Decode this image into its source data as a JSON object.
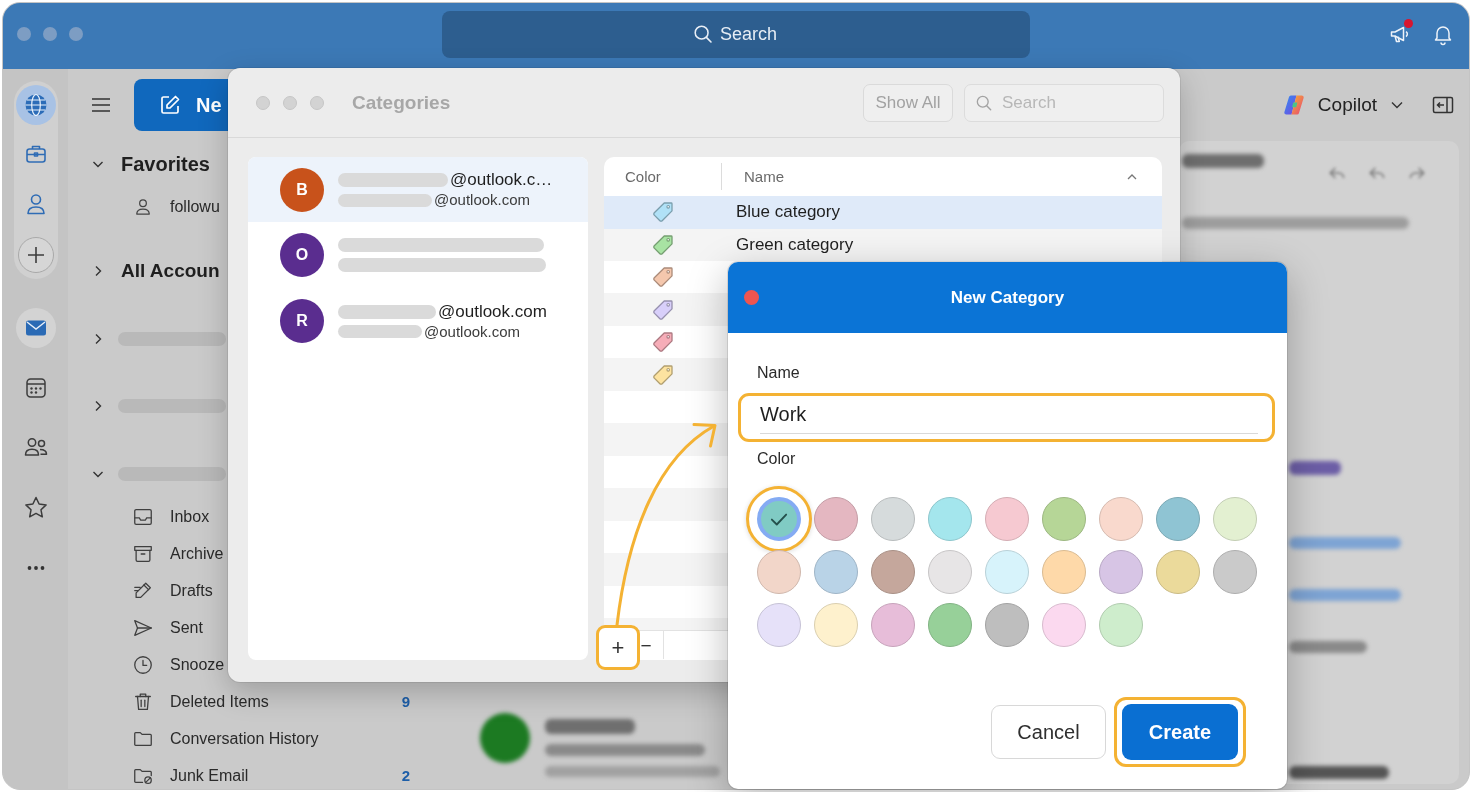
{
  "top_bar": {
    "search": {
      "placeholder": "Search"
    },
    "announcements": {
      "unread": true
    }
  },
  "rail": {
    "accounts": [
      {
        "selected": true
      },
      {
        "selected": false
      },
      {
        "selected": false
      }
    ],
    "apps": [
      {
        "selected": true
      },
      {
        "selected": false
      },
      {
        "selected": false
      },
      {
        "selected": false
      }
    ]
  },
  "toolbar": {
    "new_button": "Ne",
    "copilot": "Copilot"
  },
  "folder_pane": {
    "favorites": {
      "label": "Favorites",
      "expanded": true,
      "items": [
        {
          "label": "followu"
        }
      ]
    },
    "all_accounts": {
      "label": "All Accoun",
      "expanded": false
    },
    "accounts": [
      {
        "expanded": false
      },
      {
        "expanded": false
      },
      {
        "expanded": true,
        "folders": [
          {
            "label": "Inbox"
          },
          {
            "label": "Archive"
          },
          {
            "label": "Drafts"
          },
          {
            "label": "Sent"
          },
          {
            "label": "Snooze"
          },
          {
            "label": "Deleted Items",
            "count": "9"
          },
          {
            "label": "Conversation History"
          },
          {
            "label": "Junk Email",
            "count": "2"
          }
        ]
      }
    ]
  },
  "categories_window": {
    "title": "Categories",
    "show_all": "Show All",
    "search": {
      "placeholder": "Search"
    },
    "accounts": [
      {
        "initial": "B",
        "color": "#c8521b",
        "address": "@outlook.c…",
        "sub_address": "@outlook.com",
        "selected": true
      },
      {
        "initial": "O",
        "color": "#5a2d8f",
        "selected": false
      },
      {
        "initial": "R",
        "color": "#5a2d8f",
        "address": "@outlook.com",
        "sub_address": "@outlook.com",
        "selected": false
      }
    ],
    "table": {
      "columns": [
        {
          "label": "Color",
          "sorted": false
        },
        {
          "label": "Name",
          "sorted": true
        }
      ],
      "rows": [
        {
          "color": "#b0e1f7",
          "name": "Blue category",
          "selected": true
        },
        {
          "color": "#a8e3a3",
          "name": "Green category",
          "selected": false
        },
        {
          "color": "#f4c7ad",
          "selected": false
        },
        {
          "color": "#d8cffa",
          "selected": false
        },
        {
          "color": "#f6adb8",
          "selected": false
        },
        {
          "color": "#fde3a0",
          "selected": false
        }
      ]
    },
    "add_button": "+",
    "remove_button": "−"
  },
  "new_category_dialog": {
    "title": "New Category",
    "name_label": "Name",
    "name_value": "Work",
    "color_label": "Color",
    "colors": [
      {
        "color": "#80cbc4",
        "selected": true
      },
      {
        "color": "#e4b7c1",
        "selected": false
      },
      {
        "color": "#d6dbdc",
        "selected": false
      },
      {
        "color": "#a4e6ed",
        "selected": false
      },
      {
        "color": "#f6c9d1",
        "selected": false
      },
      {
        "color": "#b6d697",
        "selected": false
      },
      {
        "color": "#f9d9cd",
        "selected": false
      },
      {
        "color": "#8fc4d3",
        "selected": false
      },
      {
        "color": "#e3f0d1",
        "selected": false
      },
      {
        "color": "#f2d6c9",
        "selected": false
      },
      {
        "color": "#b9d3e7",
        "selected": false
      },
      {
        "color": "#c5a79c",
        "selected": false
      },
      {
        "color": "#e7e5e6",
        "selected": false
      },
      {
        "color": "#d7f3fb",
        "selected": false
      },
      {
        "color": "#fed9a9",
        "selected": false
      },
      {
        "color": "#d7c5e5",
        "selected": false
      },
      {
        "color": "#ebda9b",
        "selected": false
      },
      {
        "color": "#cacaca",
        "selected": false
      },
      {
        "color": "#e6e1f9",
        "selected": false
      },
      {
        "color": "#fef1cd",
        "selected": false
      },
      {
        "color": "#e7bdd9",
        "selected": false
      },
      {
        "color": "#97d099",
        "selected": false
      },
      {
        "color": "#bebebe",
        "selected": false
      },
      {
        "color": "#fbd9ef",
        "selected": false
      },
      {
        "color": "#ceedcc",
        "selected": false
      }
    ],
    "cancel": "Cancel",
    "create": "Create"
  }
}
